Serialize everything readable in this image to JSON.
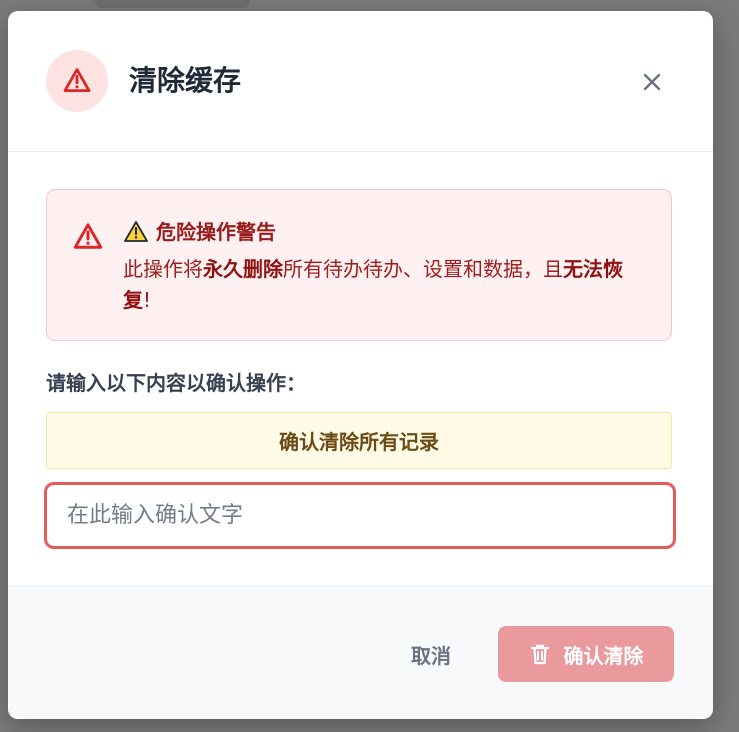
{
  "dialog": {
    "title": "清除缓存",
    "header_icon": "warning-triangle-icon",
    "close_icon": "close-icon"
  },
  "warning": {
    "icon": "warning-triangle-icon",
    "title_icon": "warning-emoji-icon",
    "title_emoji": "⚠️",
    "title": "危险操作警告",
    "text_prefix": "此操作将",
    "text_bold_1": "永久删除",
    "text_middle": "所有待办待办、设置和数据，且",
    "text_bold_2": "无法恢复",
    "text_suffix": "!"
  },
  "confirmation": {
    "label": "请输入以下内容以确认操作：",
    "phrase": "确认清除所有记录",
    "placeholder": "在此输入确认文字",
    "value": ""
  },
  "footer": {
    "cancel_label": "取消",
    "confirm_label": "确认清除",
    "confirm_icon": "trash-icon"
  },
  "colors": {
    "danger": "#dc2626",
    "danger_light": "#fde2e2",
    "warning_bg": "#fff1f1",
    "phrase_bg": "#fffbe6",
    "disabled_button": "#ea9a9c"
  }
}
